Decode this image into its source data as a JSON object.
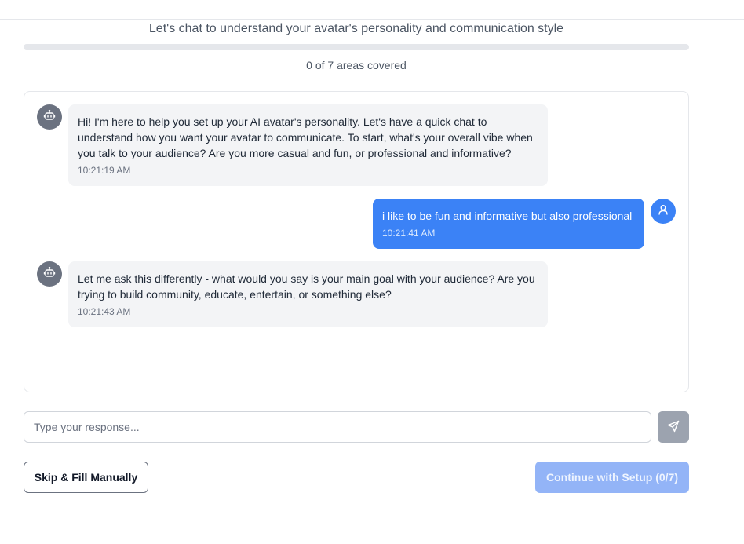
{
  "header": {
    "subtitle": "Let's chat to understand your avatar's personality and communication style"
  },
  "progress": {
    "covered": 0,
    "total": 7,
    "fraction": 0,
    "label": "0 of 7 areas covered"
  },
  "messages": [
    {
      "sender": "bot",
      "icon": "bot-icon",
      "text": "Hi! I'm here to help you set up your AI avatar's personality. Let's have a quick chat to understand how you want your avatar to communicate. To start, what's your overall vibe when you talk to your audience? Are you more casual and fun, or professional and informative?",
      "time": "10:21:19 AM"
    },
    {
      "sender": "user",
      "icon": "user-icon",
      "text": "i like to be fun and informative but also professional",
      "time": "10:21:41 AM"
    },
    {
      "sender": "bot",
      "icon": "bot-icon",
      "text": "Let me ask this differently - what would you say is your main goal with your audience? Are you trying to build community, educate, entertain, or something else?",
      "time": "10:21:43 AM"
    }
  ],
  "composer": {
    "placeholder": "Type your response...",
    "value": "",
    "send_icon": "send-icon"
  },
  "actions": {
    "skip_label": "Skip & Fill Manually",
    "continue_label": "Continue with Setup (0/7)",
    "continue_disabled": true
  },
  "colors": {
    "accent": "#3b82f6",
    "bot_bubble": "#f3f4f6",
    "bot_avatar": "#6b7280",
    "continue_disabled": "#93b4f7",
    "send_button": "#9ca3af"
  }
}
